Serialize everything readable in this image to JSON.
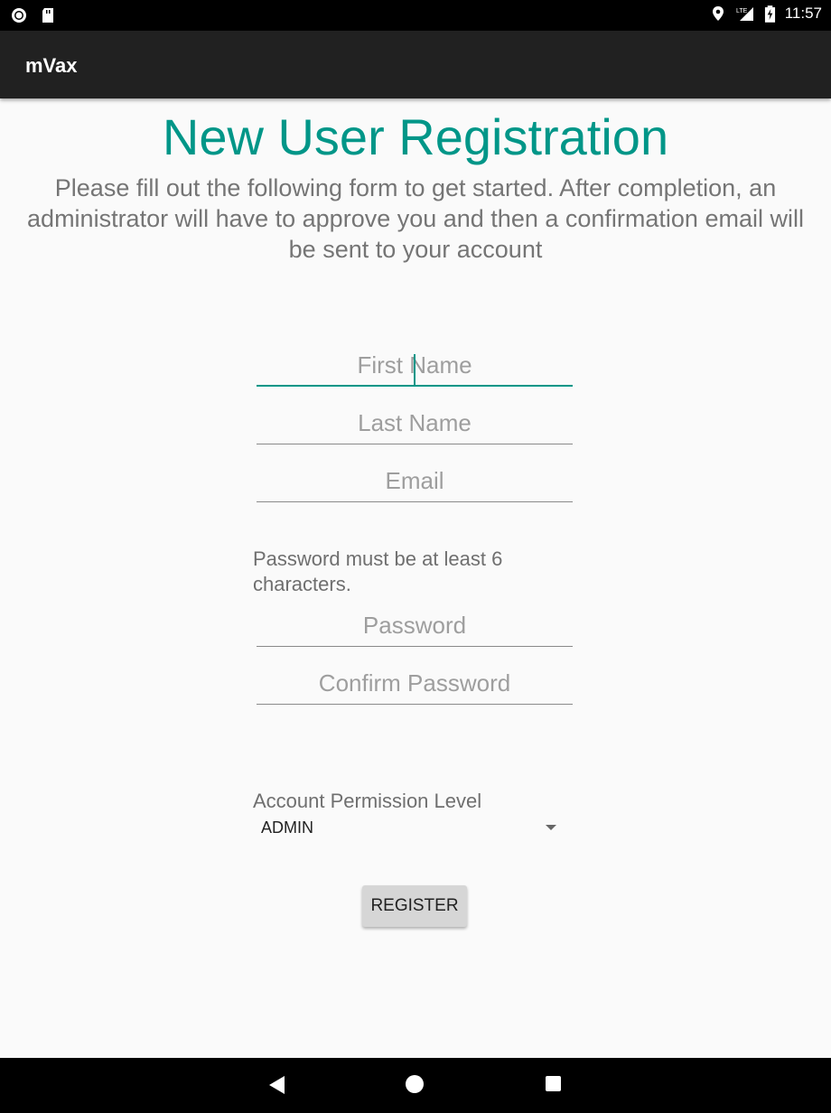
{
  "status_bar": {
    "time": "11:57",
    "icons": [
      "record-icon",
      "sd-card-icon",
      "location-icon",
      "lte-signal-icon",
      "battery-charging-icon"
    ]
  },
  "app_bar": {
    "title": "mVax"
  },
  "form": {
    "heading": "New User Registration",
    "intro": "Please fill out the following form to get started. After completion, an administrator will have to approve you and then a confirmation email will be sent to your account",
    "first_name": {
      "placeholder": "First Name",
      "value": ""
    },
    "last_name": {
      "placeholder": "Last Name",
      "value": ""
    },
    "email": {
      "placeholder": "Email",
      "value": ""
    },
    "password_hint": "Password must be at least 6 characters.",
    "password": {
      "placeholder": "Password",
      "value": ""
    },
    "confirm_password": {
      "placeholder": "Confirm Password",
      "value": ""
    },
    "permission_label": "Account Permission Level",
    "permission_selected": "ADMIN",
    "register_label": "REGISTER"
  },
  "colors": {
    "accent": "#009688",
    "app_bar": "#212121",
    "status_bar": "#000000",
    "background": "#fafafa"
  },
  "nav_bar": {
    "icons": [
      "back-icon",
      "home-icon",
      "recents-icon"
    ]
  }
}
